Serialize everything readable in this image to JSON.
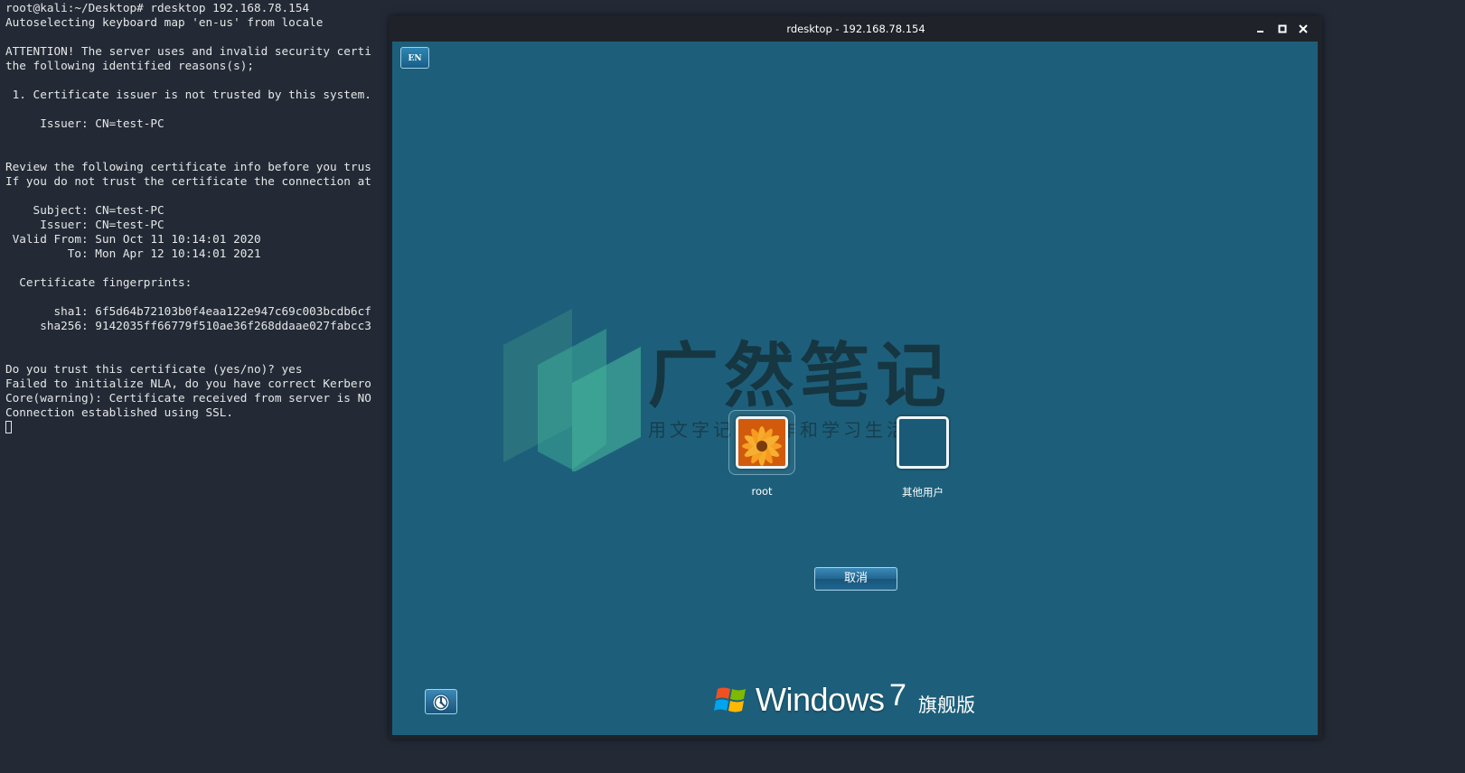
{
  "terminal": {
    "lines": [
      "root@kali:~/Desktop# rdesktop 192.168.78.154",
      "Autoselecting keyboard map 'en-us' from locale",
      "",
      "ATTENTION! The server uses and invalid security certi",
      "the following identified reasons(s);",
      "",
      " 1. Certificate issuer is not trusted by this system.",
      "",
      "     Issuer: CN=test-PC",
      "",
      "",
      "Review the following certificate info before you trus",
      "If you do not trust the certificate the connection at",
      "",
      "    Subject: CN=test-PC",
      "     Issuer: CN=test-PC",
      " Valid From: Sun Oct 11 10:14:01 2020",
      "         To: Mon Apr 12 10:14:01 2021",
      "",
      "  Certificate fingerprints:",
      "",
      "       sha1: 6f5d64b72103b0f4eaa122e947c69c003bcdb6cf",
      "     sha256: 9142035ff66779f510ae36f268ddaae027fabcc3",
      "",
      "",
      "Do you trust this certificate (yes/no)? yes",
      "Failed to initialize NLA, do you have correct Kerbero",
      "Core(warning): Certificate received from server is NO",
      "Connection established using SSL."
    ]
  },
  "rdesktop": {
    "title": "rdesktop - 192.168.78.154",
    "controls": {
      "minimize_icon": "minimize-icon",
      "maximize_icon": "maximize-icon",
      "close_icon": "close-icon"
    },
    "language_indicator": "EN",
    "users": [
      {
        "name": "root",
        "icon": "flower-avatar-icon"
      },
      {
        "name": "其他用户",
        "icon": "blank-avatar-icon"
      }
    ],
    "cancel_label": "取消",
    "ease_of_access_icon": "ease-of-access-icon",
    "brand": {
      "word": "Windows",
      "version": "7",
      "edition": "旗舰版",
      "logo_icon": "windows-flag-icon"
    },
    "watermark": {
      "title": "广然笔记",
      "subtitle": "用文字记录工作和学习生活"
    },
    "colors": {
      "desktop_bg": "#1d5f7a",
      "terminal_bg": "#232a36",
      "window_frame": "#1f2229"
    }
  }
}
